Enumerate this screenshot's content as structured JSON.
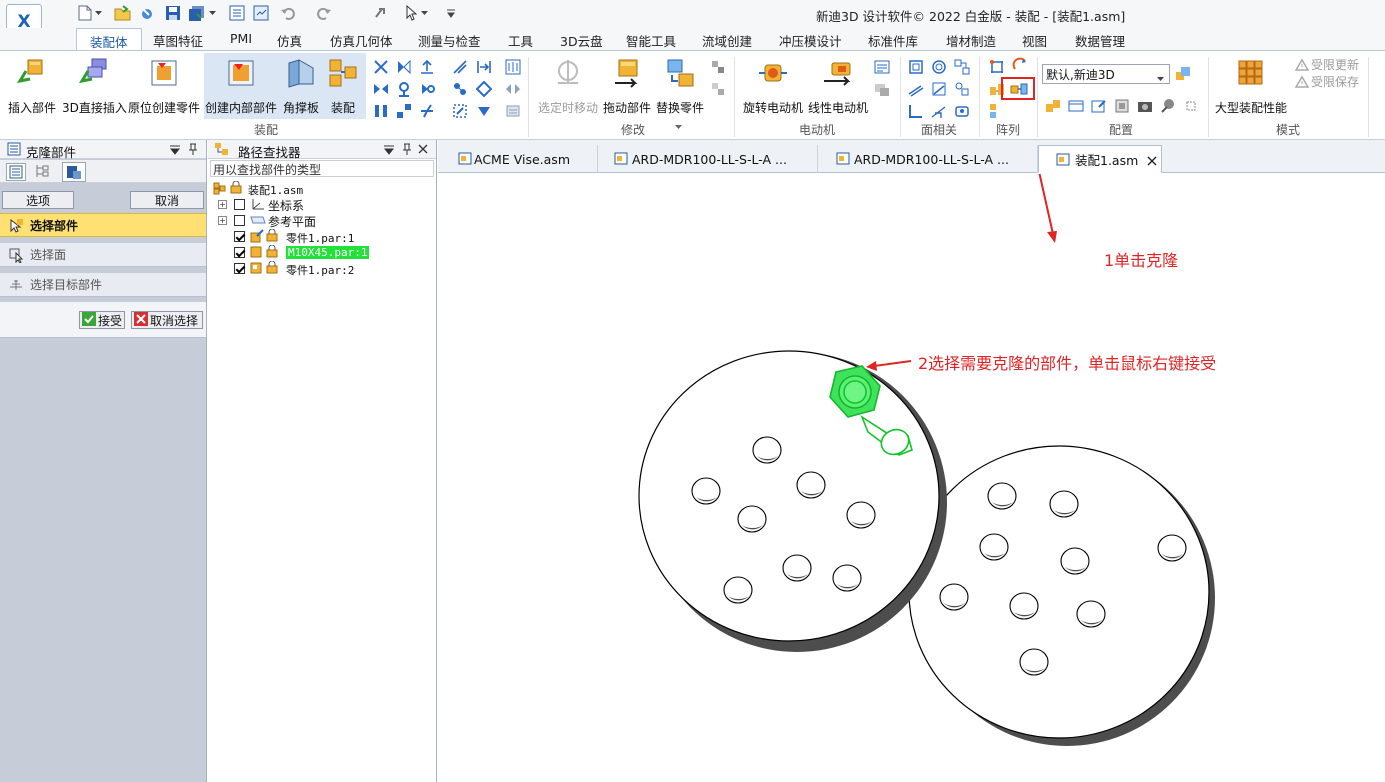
{
  "app": {
    "title": "新迪3D 设计软件© 2022 白金版 - 装配 - [装配1.asm]",
    "logo_text": "X"
  },
  "menu_tabs": [
    "装配体",
    "草图特征",
    "PMI",
    "仿真",
    "仿真几何体",
    "测量与检查",
    "工具",
    "3D云盘",
    "智能工具",
    "流域创建",
    "冲压模设计",
    "标准件库",
    "增材制造",
    "视图",
    "数据管理"
  ],
  "ribbon": {
    "assembly": {
      "insert_part": "插入部件",
      "direct_insert_3d": "3D直接插入",
      "create_in_place": "原位创建零件",
      "create_internal": "创建内部部件",
      "gusset": "角撑板",
      "assemble": "装配",
      "group": "装配"
    },
    "modify": {
      "move_selected": "选定时移动",
      "drag_part": "拖动部件",
      "replace_part": "替换零件",
      "group": "修改"
    },
    "motor": {
      "rotary_motor": "旋转电动机",
      "linear_motor": "线性电动机",
      "group": "电动机"
    },
    "face": {
      "group": "面相关"
    },
    "pattern": {
      "group": "阵列"
    },
    "config": {
      "select_value": "默认,新迪3D",
      "group": "配置"
    },
    "mode": {
      "large_assembly": "大型装配性能",
      "limited_update": "受限更新",
      "limited_save": "受限保存",
      "group": "模式"
    }
  },
  "clone_panel": {
    "title": "克隆部件",
    "options": "选项",
    "cancel": "取消",
    "step_select_part": "选择部件",
    "step_select_face": "选择面",
    "step_select_target": "选择目标部件",
    "accept": "接受",
    "cancel_select": "取消选择"
  },
  "pathfinder": {
    "title": "路径查找器",
    "hint": "用以查找部件的类型",
    "root": "装配1.asm",
    "items": [
      "坐标系",
      "参考平面",
      "零件1.par:1",
      "M10X45.par:1",
      "零件1.par:2"
    ]
  },
  "doc_tabs": [
    "ACME Vise.asm",
    "ARD-MDR100-LL-S-L-A ...",
    "ARD-MDR100-LL-S-L-A ...",
    "装配1.asm"
  ],
  "annotations": {
    "step1": "1单击克隆",
    "step2": "2选择需要克隆的部件，单击鼠标右键接受"
  },
  "colors": {
    "accent": "#1a57a8",
    "annotation": "#e02424",
    "selected_part": "#22e23a",
    "highlight_step": "#ffe173"
  }
}
